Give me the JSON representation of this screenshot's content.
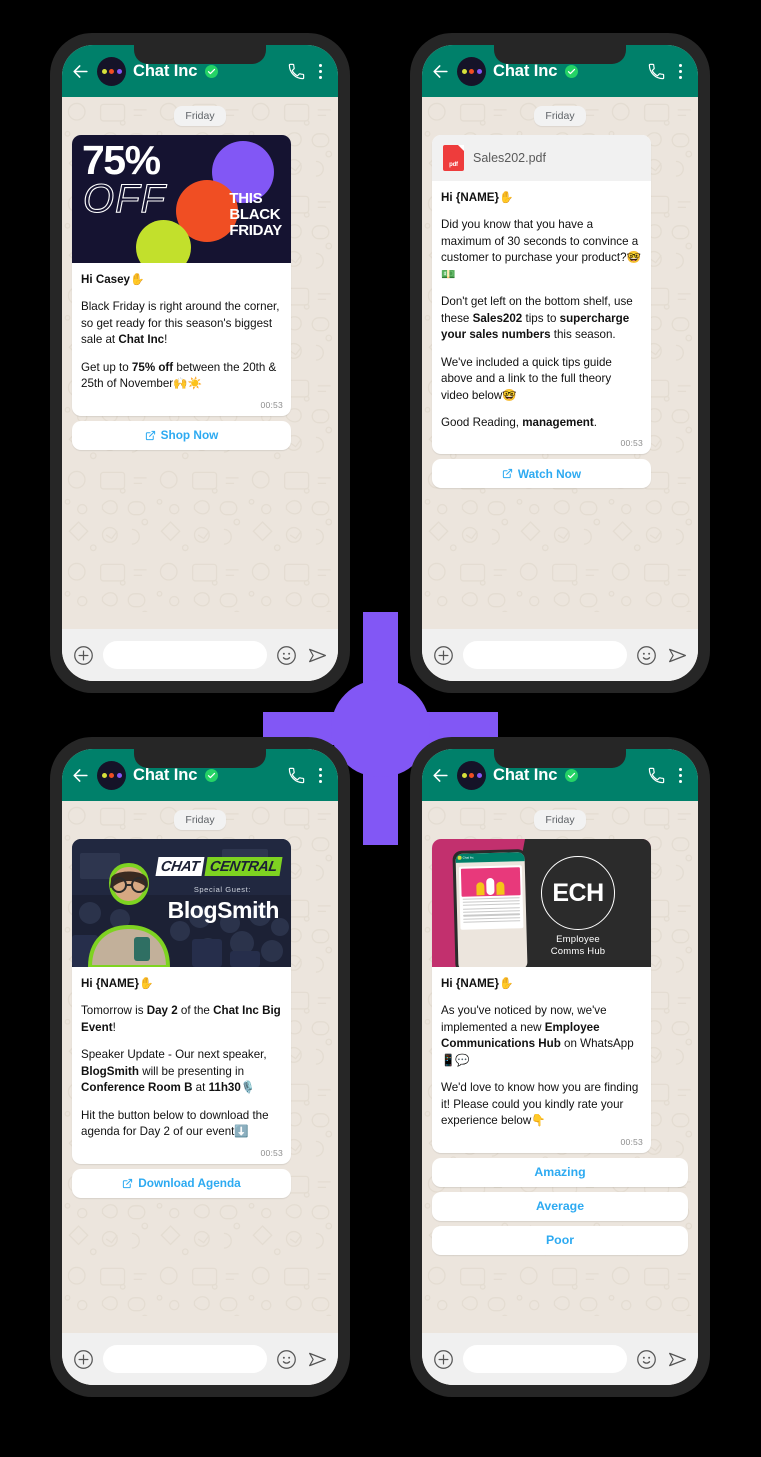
{
  "theme": {
    "page_background": "#000000",
    "phone_frame": "#262626",
    "header_green": "#00806a",
    "chat_wallpaper": "#ece5dd",
    "accent_purple": "#8257f5",
    "link_blue": "#2daaf1",
    "verified_green": "#25d366"
  },
  "header": {
    "contact_name": "Chat Inc",
    "back_icon": "arrow-left-icon",
    "avatar_icon": "chat-inc-avatar",
    "verified_icon": "verified-badge-icon",
    "call_icon": "phone-call-icon",
    "menu_icon": "overflow-menu-icon"
  },
  "input_bar": {
    "plus_icon": "attach-plus-icon",
    "value": "",
    "placeholder": "",
    "emoji_icon": "emoji-smiley-icon",
    "send_icon": "send-arrow-icon"
  },
  "phones": [
    {
      "id": "black-friday",
      "day_label": "Friday",
      "creative": {
        "type": "black-friday-banner",
        "headline_percent": "75%",
        "headline_off": "OFF",
        "tagline": "THIS\nBLACK\nFRIDAY",
        "tagline_lines": [
          "THIS",
          "BLACK",
          "FRIDAY"
        ],
        "background": "#151331",
        "circle_colors": [
          "#8257f5",
          "#f04e23",
          "#c2e02c"
        ]
      },
      "greeting": "Hi Casey",
      "greeting_emoji": "✋",
      "paragraphs": [
        "Black Friday is right around the corner, so get ready for this season's biggest sale at Chat Inc!",
        "Get up to 75% off between the 20th & 25th of November🙌☀️"
      ],
      "timestamp": "00:53",
      "cta": {
        "label": "Shop Now",
        "icon": "external-link-icon"
      }
    },
    {
      "id": "sales-pdf",
      "day_label": "Friday",
      "attachment": {
        "file_name": "Sales202.pdf",
        "icon": "pdf-file-icon",
        "type": "pdf"
      },
      "greeting": "Hi {NAME}",
      "greeting_emoji": "✋",
      "paragraphs": [
        "Did you know that you have a maximum of 30 seconds to convince a customer to purchase your product?🤓💵",
        "Don't get left on the bottom shelf, use these Sales202 tips to supercharge your sales numbers this season.",
        "We've included a quick tips guide above and a link to the full theory video below🤓",
        "Good Reading, management."
      ],
      "timestamp": "00:53",
      "cta": {
        "label": "Watch Now",
        "icon": "external-link-icon"
      }
    },
    {
      "id": "chat-central-event",
      "day_label": "Friday",
      "creative": {
        "type": "chat-central-banner",
        "logo_part1": "CHAT",
        "logo_part2": "CENTRAL",
        "guest_label": "Special Guest:",
        "guest_name": "BlogSmith",
        "accent": "#7ed321"
      },
      "greeting": "Hi {NAME}",
      "greeting_emoji": "✋",
      "paragraphs": [
        "Tomorrow is Day 2 of the Chat Inc Big Event!",
        "Speaker Update - Our next speaker, BlogSmith will be presenting in Conference Room B at 11h30🎙️",
        "Hit the button below to download the agenda for Day 2 of our event⬇️"
      ],
      "timestamp": "00:53",
      "cta": {
        "label": "Download Agenda",
        "icon": "external-link-icon"
      }
    },
    {
      "id": "employee-comms-hub",
      "day_label": "Friday",
      "creative": {
        "type": "ech-banner",
        "acronym": "ECH",
        "subtitle_line1": "Employee",
        "subtitle_line2": "Comms Hub",
        "background_left": "#c2306e",
        "background_right": "#2b2b2b"
      },
      "greeting": "Hi {NAME}",
      "greeting_emoji": "✋",
      "paragraphs": [
        "As you've noticed by now, we've implemented a new Employee Communications Hub on WhatsApp📱💬",
        "We'd love to know how you are finding it! Please could you kindly rate your experience below👇"
      ],
      "timestamp": "00:53",
      "quick_replies": [
        "Amazing",
        "Average",
        "Poor"
      ]
    }
  ]
}
